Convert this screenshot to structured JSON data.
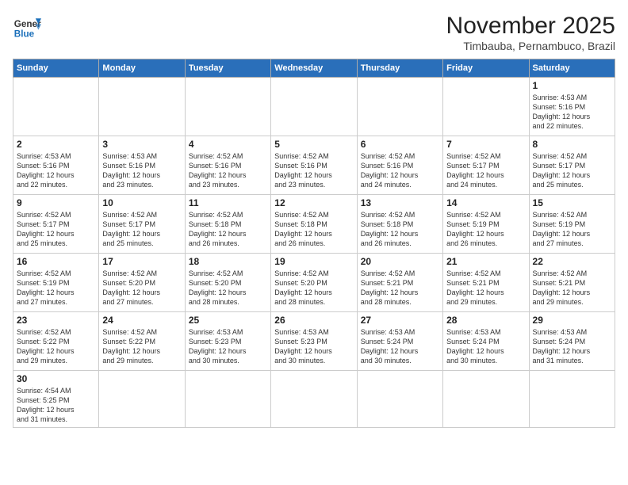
{
  "header": {
    "logo_line1": "General",
    "logo_line2": "Blue",
    "month": "November 2025",
    "location": "Timbauba, Pernambuco, Brazil"
  },
  "weekdays": [
    "Sunday",
    "Monday",
    "Tuesday",
    "Wednesday",
    "Thursday",
    "Friday",
    "Saturday"
  ],
  "weeks": [
    [
      {
        "day": "",
        "info": ""
      },
      {
        "day": "",
        "info": ""
      },
      {
        "day": "",
        "info": ""
      },
      {
        "day": "",
        "info": ""
      },
      {
        "day": "",
        "info": ""
      },
      {
        "day": "",
        "info": ""
      },
      {
        "day": "1",
        "info": "Sunrise: 4:53 AM\nSunset: 5:16 PM\nDaylight: 12 hours\nand 22 minutes."
      }
    ],
    [
      {
        "day": "2",
        "info": "Sunrise: 4:53 AM\nSunset: 5:16 PM\nDaylight: 12 hours\nand 22 minutes."
      },
      {
        "day": "3",
        "info": "Sunrise: 4:53 AM\nSunset: 5:16 PM\nDaylight: 12 hours\nand 23 minutes."
      },
      {
        "day": "4",
        "info": "Sunrise: 4:52 AM\nSunset: 5:16 PM\nDaylight: 12 hours\nand 23 minutes."
      },
      {
        "day": "5",
        "info": "Sunrise: 4:52 AM\nSunset: 5:16 PM\nDaylight: 12 hours\nand 23 minutes."
      },
      {
        "day": "6",
        "info": "Sunrise: 4:52 AM\nSunset: 5:16 PM\nDaylight: 12 hours\nand 24 minutes."
      },
      {
        "day": "7",
        "info": "Sunrise: 4:52 AM\nSunset: 5:17 PM\nDaylight: 12 hours\nand 24 minutes."
      },
      {
        "day": "8",
        "info": "Sunrise: 4:52 AM\nSunset: 5:17 PM\nDaylight: 12 hours\nand 25 minutes."
      }
    ],
    [
      {
        "day": "9",
        "info": "Sunrise: 4:52 AM\nSunset: 5:17 PM\nDaylight: 12 hours\nand 25 minutes."
      },
      {
        "day": "10",
        "info": "Sunrise: 4:52 AM\nSunset: 5:17 PM\nDaylight: 12 hours\nand 25 minutes."
      },
      {
        "day": "11",
        "info": "Sunrise: 4:52 AM\nSunset: 5:18 PM\nDaylight: 12 hours\nand 26 minutes."
      },
      {
        "day": "12",
        "info": "Sunrise: 4:52 AM\nSunset: 5:18 PM\nDaylight: 12 hours\nand 26 minutes."
      },
      {
        "day": "13",
        "info": "Sunrise: 4:52 AM\nSunset: 5:18 PM\nDaylight: 12 hours\nand 26 minutes."
      },
      {
        "day": "14",
        "info": "Sunrise: 4:52 AM\nSunset: 5:19 PM\nDaylight: 12 hours\nand 26 minutes."
      },
      {
        "day": "15",
        "info": "Sunrise: 4:52 AM\nSunset: 5:19 PM\nDaylight: 12 hours\nand 27 minutes."
      }
    ],
    [
      {
        "day": "16",
        "info": "Sunrise: 4:52 AM\nSunset: 5:19 PM\nDaylight: 12 hours\nand 27 minutes."
      },
      {
        "day": "17",
        "info": "Sunrise: 4:52 AM\nSunset: 5:20 PM\nDaylight: 12 hours\nand 27 minutes."
      },
      {
        "day": "18",
        "info": "Sunrise: 4:52 AM\nSunset: 5:20 PM\nDaylight: 12 hours\nand 28 minutes."
      },
      {
        "day": "19",
        "info": "Sunrise: 4:52 AM\nSunset: 5:20 PM\nDaylight: 12 hours\nand 28 minutes."
      },
      {
        "day": "20",
        "info": "Sunrise: 4:52 AM\nSunset: 5:21 PM\nDaylight: 12 hours\nand 28 minutes."
      },
      {
        "day": "21",
        "info": "Sunrise: 4:52 AM\nSunset: 5:21 PM\nDaylight: 12 hours\nand 29 minutes."
      },
      {
        "day": "22",
        "info": "Sunrise: 4:52 AM\nSunset: 5:21 PM\nDaylight: 12 hours\nand 29 minutes."
      }
    ],
    [
      {
        "day": "23",
        "info": "Sunrise: 4:52 AM\nSunset: 5:22 PM\nDaylight: 12 hours\nand 29 minutes."
      },
      {
        "day": "24",
        "info": "Sunrise: 4:52 AM\nSunset: 5:22 PM\nDaylight: 12 hours\nand 29 minutes."
      },
      {
        "day": "25",
        "info": "Sunrise: 4:53 AM\nSunset: 5:23 PM\nDaylight: 12 hours\nand 30 minutes."
      },
      {
        "day": "26",
        "info": "Sunrise: 4:53 AM\nSunset: 5:23 PM\nDaylight: 12 hours\nand 30 minutes."
      },
      {
        "day": "27",
        "info": "Sunrise: 4:53 AM\nSunset: 5:24 PM\nDaylight: 12 hours\nand 30 minutes."
      },
      {
        "day": "28",
        "info": "Sunrise: 4:53 AM\nSunset: 5:24 PM\nDaylight: 12 hours\nand 30 minutes."
      },
      {
        "day": "29",
        "info": "Sunrise: 4:53 AM\nSunset: 5:24 PM\nDaylight: 12 hours\nand 31 minutes."
      }
    ],
    [
      {
        "day": "30",
        "info": "Sunrise: 4:54 AM\nSunset: 5:25 PM\nDaylight: 12 hours\nand 31 minutes."
      },
      {
        "day": "",
        "info": ""
      },
      {
        "day": "",
        "info": ""
      },
      {
        "day": "",
        "info": ""
      },
      {
        "day": "",
        "info": ""
      },
      {
        "day": "",
        "info": ""
      },
      {
        "day": "",
        "info": ""
      }
    ]
  ]
}
